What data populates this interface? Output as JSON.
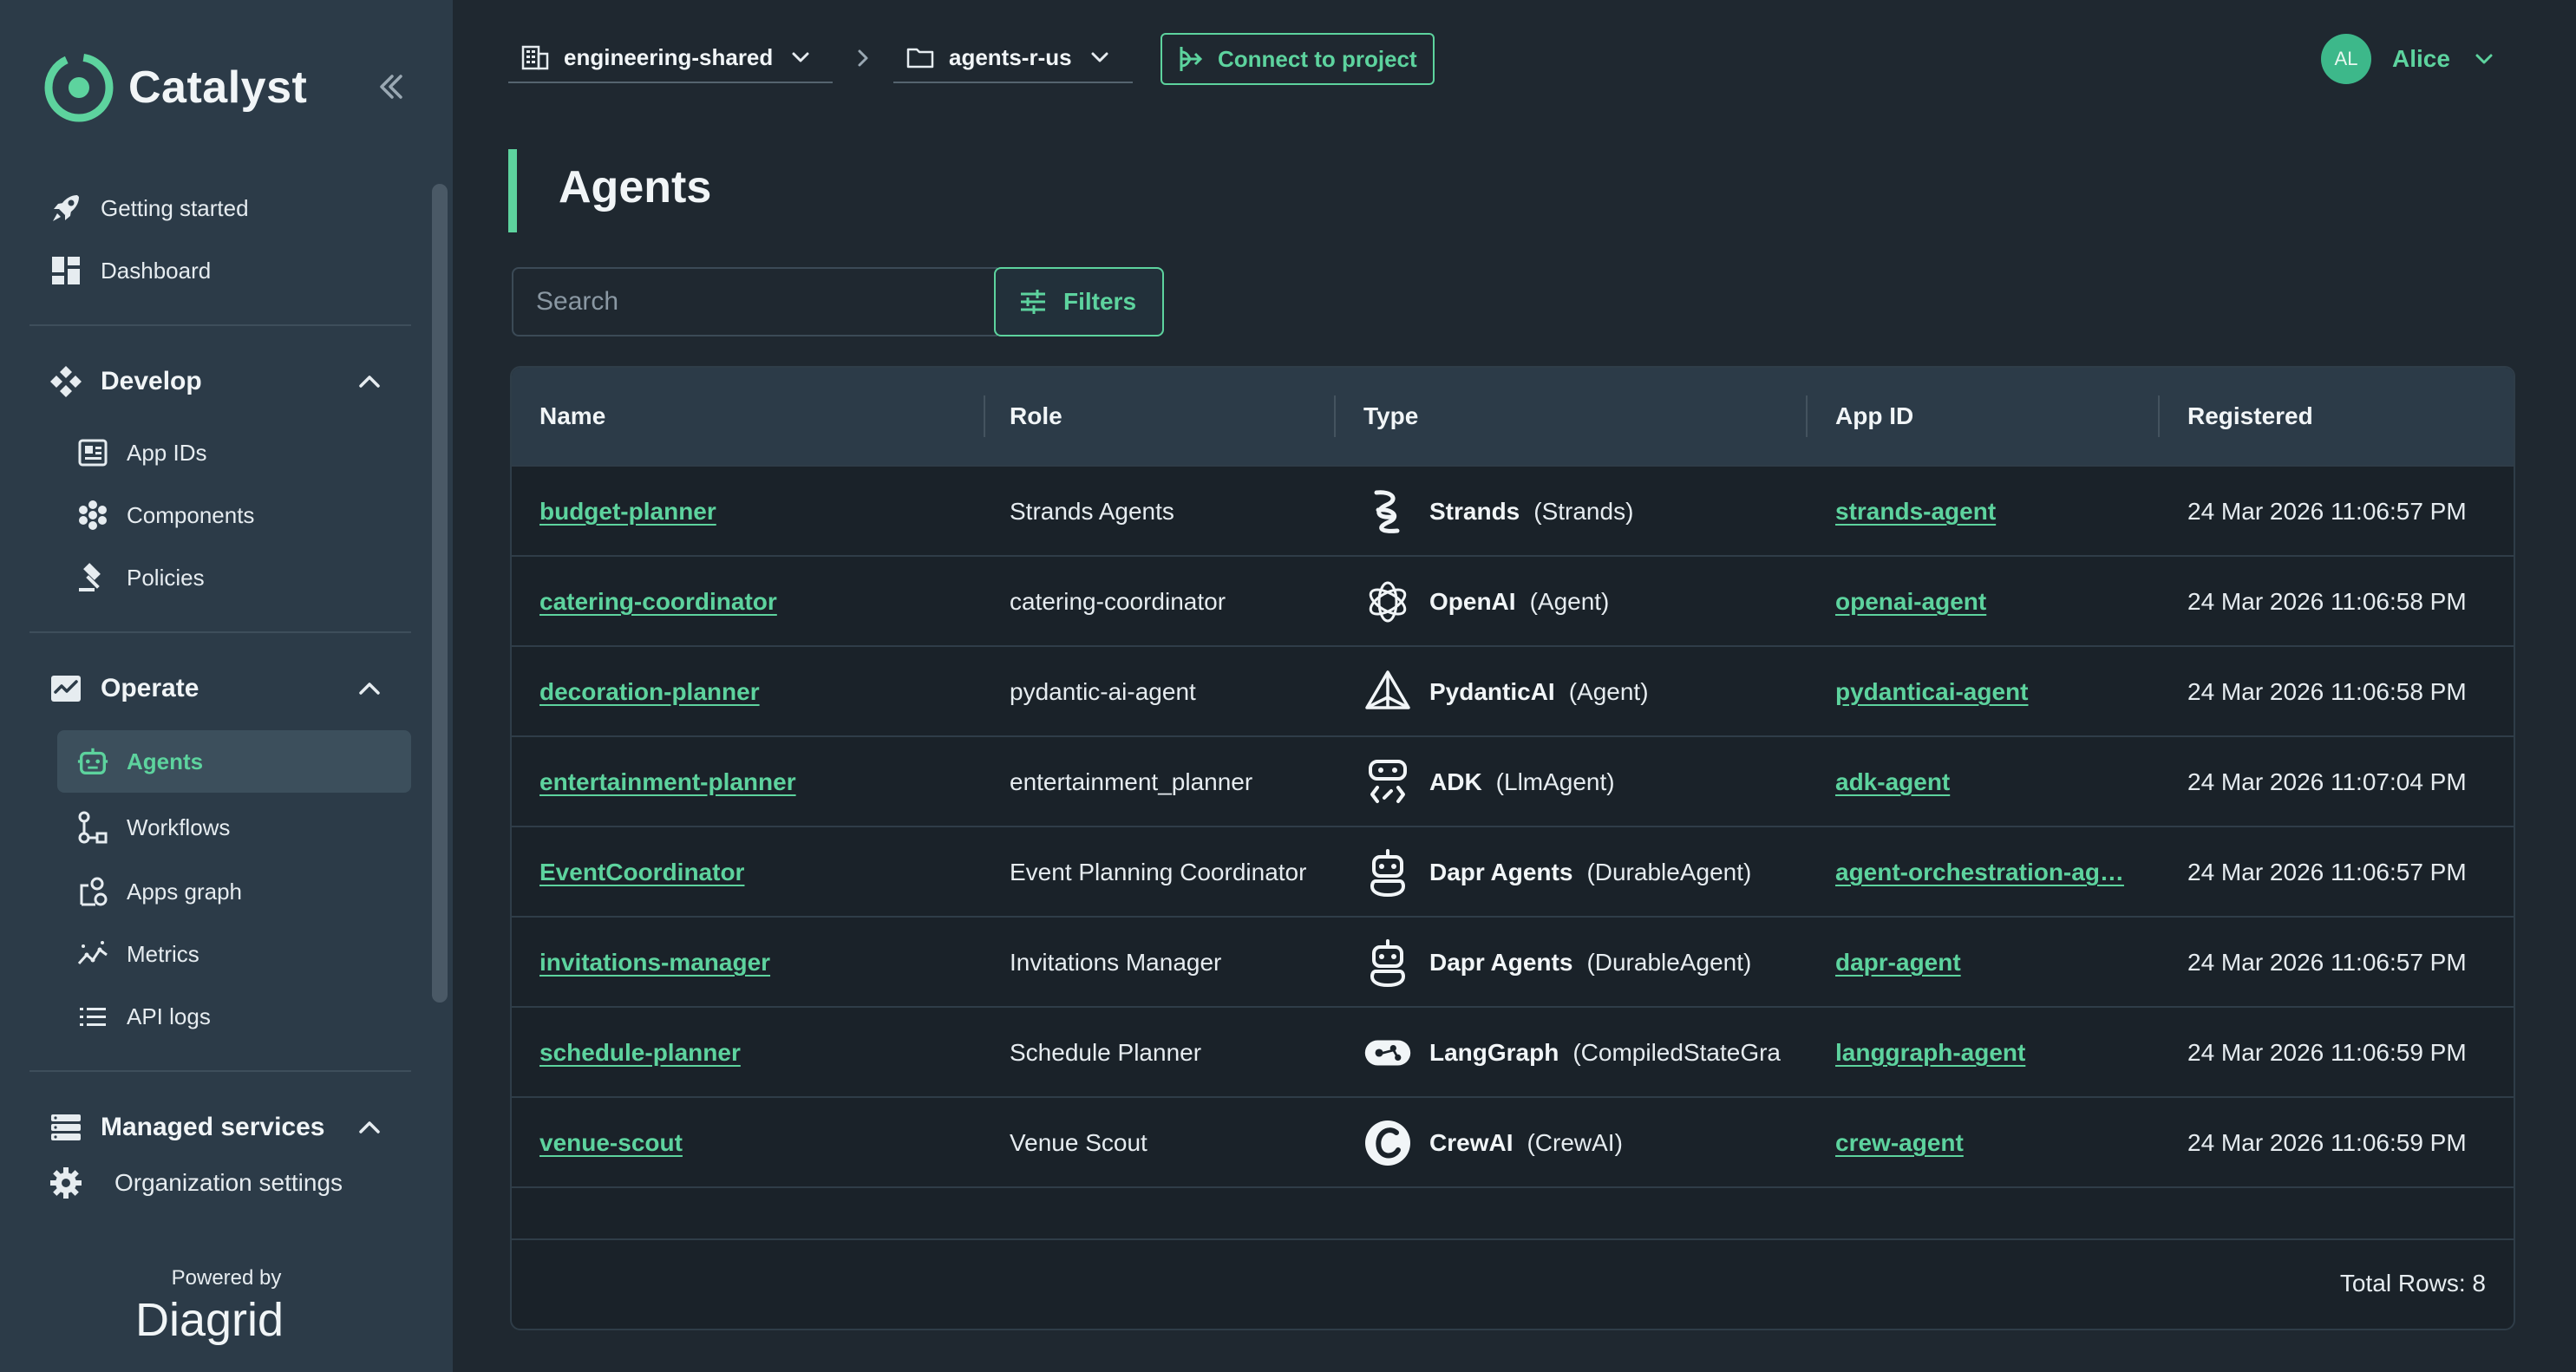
{
  "app": {
    "name": "Catalyst"
  },
  "sidebar": {
    "top_items": [
      {
        "label": "Getting started",
        "icon": "rocket-icon"
      },
      {
        "label": "Dashboard",
        "icon": "dashboard-icon"
      }
    ],
    "develop": {
      "label": "Develop",
      "items": [
        {
          "label": "App IDs",
          "icon": "app-id-icon"
        },
        {
          "label": "Components",
          "icon": "components-icon"
        },
        {
          "label": "Policies",
          "icon": "gavel-icon"
        }
      ]
    },
    "operate": {
      "label": "Operate",
      "items": [
        {
          "label": "Agents",
          "icon": "robot-icon",
          "active": true
        },
        {
          "label": "Workflows",
          "icon": "workflow-icon"
        },
        {
          "label": "Apps graph",
          "icon": "graph-icon"
        },
        {
          "label": "Metrics",
          "icon": "metrics-icon"
        },
        {
          "label": "API logs",
          "icon": "list-icon"
        }
      ]
    },
    "managed": {
      "label": "Managed services"
    },
    "org_settings": "Organization settings",
    "powered_by": "Powered by",
    "footer_brand": "Diagrid"
  },
  "topbar": {
    "org": "engineering-shared",
    "project": "agents-r-us",
    "connect_label": "Connect to project",
    "user_initials": "AL",
    "user_name": "Alice"
  },
  "page": {
    "title": "Agents"
  },
  "search": {
    "placeholder": "Search"
  },
  "filters_label": "Filters",
  "table": {
    "columns": [
      "Name",
      "Role",
      "Type",
      "App ID",
      "Registered"
    ],
    "rows": [
      {
        "name": "budget-planner",
        "role": "Strands Agents",
        "type": "Strands",
        "subtype": "(Strands)",
        "type_icon": "strands-icon",
        "app_id": "strands-agent",
        "registered": "24 Mar 2026 11:06:57 PM"
      },
      {
        "name": "catering-coordinator",
        "role": "catering-coordinator",
        "type": "OpenAI",
        "subtype": "(Agent)",
        "type_icon": "openai-icon",
        "app_id": "openai-agent",
        "registered": "24 Mar 2026 11:06:58 PM"
      },
      {
        "name": "decoration-planner",
        "role": "pydantic-ai-agent",
        "type": "PydanticAI",
        "subtype": "(Agent)",
        "type_icon": "pydantic-icon",
        "app_id": "pydanticai-agent",
        "registered": "24 Mar 2026 11:06:58 PM"
      },
      {
        "name": "entertainment-planner",
        "role": "entertainment_planner",
        "type": "ADK",
        "subtype": "(LlmAgent)",
        "type_icon": "adk-icon",
        "app_id": "adk-agent",
        "registered": "24 Mar 2026 11:07:04 PM"
      },
      {
        "name": "EventCoordinator",
        "role": "Event Planning Coordinator",
        "type": "Dapr Agents",
        "subtype": "(DurableAgent)",
        "type_icon": "dapr-robot-icon",
        "app_id": "agent-orchestration-ag…",
        "registered": "24 Mar 2026 11:06:57 PM"
      },
      {
        "name": "invitations-manager",
        "role": "Invitations Manager",
        "type": "Dapr Agents",
        "subtype": "(DurableAgent)",
        "type_icon": "dapr-robot-icon",
        "app_id": "dapr-agent",
        "registered": "24 Mar 2026 11:06:57 PM"
      },
      {
        "name": "schedule-planner",
        "role": "Schedule Planner",
        "type": "LangGraph",
        "subtype": "(CompiledStateGra",
        "type_icon": "langgraph-icon",
        "app_id": "langgraph-agent",
        "registered": "24 Mar 2026 11:06:59 PM"
      },
      {
        "name": "venue-scout",
        "role": "Venue Scout",
        "type": "CrewAI",
        "subtype": "(CrewAI)",
        "type_icon": "crewai-icon",
        "app_id": "crew-agent",
        "registered": "24 Mar 2026 11:06:59 PM"
      }
    ],
    "total_label": "Total Rows: 8"
  },
  "colors": {
    "accent": "#5dd39e",
    "sidebar_bg": "#2c3b48",
    "main_bg": "#1f2830"
  }
}
